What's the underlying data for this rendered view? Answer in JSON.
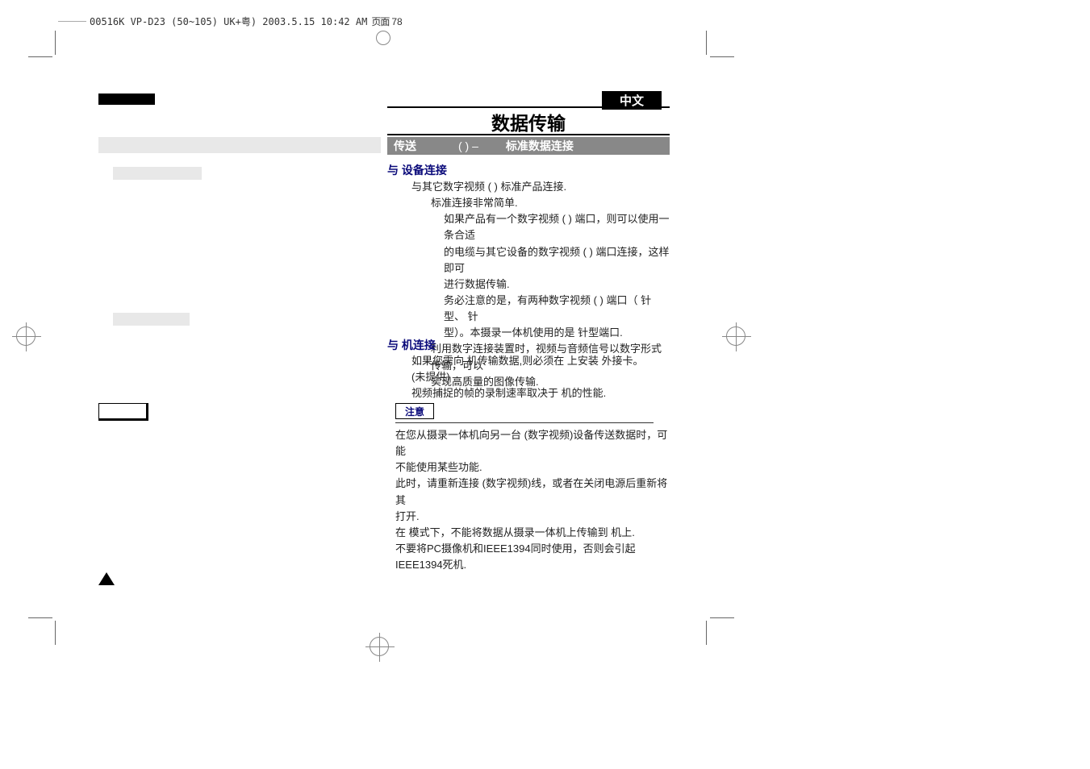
{
  "filename": "00516K VP-D23 (50~105) UK+粤)  2003.5.15 10:42 AM",
  "page_label": "页面",
  "page_num": "78",
  "lang_badge": "中文",
  "main_heading": "数据传输",
  "section_bar": {
    "prefix": "传送",
    "paren": "(          )  –",
    "suffix": "标准数据连接"
  },
  "subhead1": "与    设备连接",
  "body1": {
    "l1": "与其它数字视频 (      ) 标准产品连接.",
    "l2": "标准连接非常简单.",
    "l3": "如果产品有一个数字视频 (      ) 端口，则可以使用一条合适",
    "l4": "的电缆与其它设备的数字视频 (      ) 端口连接，这样即可",
    "l5": "进行数据传输.",
    "l6": "务必注意的是，有两种数字视频 (      ) 端口（  针型、  针",
    "l7": "型）。本摄录一体机使用的是  针型端口.",
    "l8": "利用数字连接装置时，视频与音频信号以数字形式传输，可以",
    "l9": "实现高质量的图像传输."
  },
  "subhead2": "与    机连接",
  "body2": {
    "l1": "如果您需向    机传输数据,则必须在    上安装               外接卡。",
    "l2": "(未提供)",
    "l3": "视频捕捉的帧的录制速率取决于    机的性能."
  },
  "notice_label": "注意",
  "notice": {
    "l1": "在您从摄录一体机向另一台       (数字视频)设备传送数据时，可能",
    "l2": "不能使用某些功能.",
    "l3": "此时，请重新连接       (数字视频)线，或者在关闭电源后重新将其",
    "l4": "打开.",
    "l5": "在            模式下，不能将数据从摄录一体机上传输到    机上.",
    "l6": "不要将PC摄像机和IEEE1394同时使用，否则会引起IEEE1394死机."
  }
}
